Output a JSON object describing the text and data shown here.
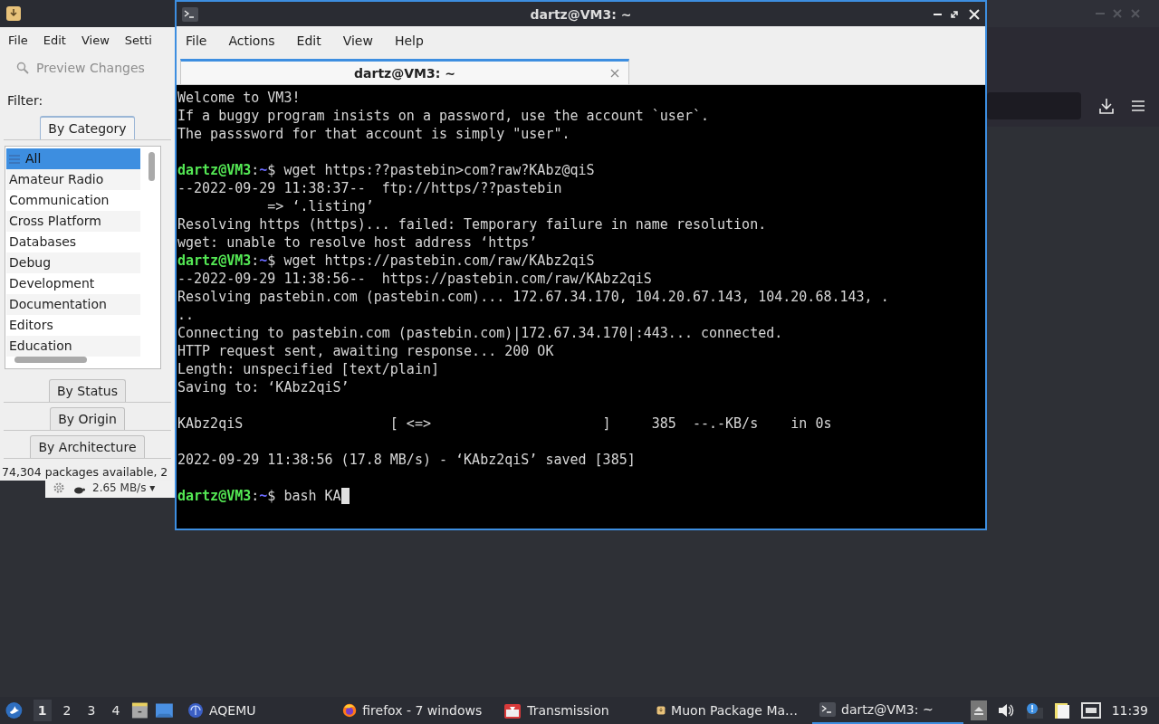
{
  "muon": {
    "menu": [
      "File",
      "Edit",
      "View",
      "Setti"
    ],
    "toolbar_action": {
      "label": "Preview Changes",
      "disabled": true
    },
    "filter_label": "Filter:",
    "filter_tabs": [
      {
        "label": "By Category",
        "selected": true
      },
      {
        "label": "By Status",
        "selected": false
      },
      {
        "label": "By Origin",
        "selected": false
      },
      {
        "label": "By Architecture",
        "selected": false
      }
    ],
    "categories": [
      {
        "label": "All",
        "selected": true
      },
      {
        "label": "Amateur Radio",
        "selected": false
      },
      {
        "label": "Communication",
        "selected": false
      },
      {
        "label": "Cross Platform",
        "selected": false
      },
      {
        "label": "Databases",
        "selected": false
      },
      {
        "label": "Debug",
        "selected": false
      },
      {
        "label": "Development",
        "selected": false
      },
      {
        "label": "Documentation",
        "selected": false
      },
      {
        "label": "Editors",
        "selected": false
      },
      {
        "label": "Education",
        "selected": false
      }
    ],
    "status_bar": "74,304 packages available, 2"
  },
  "transmission_bar": {
    "speed": "2.65 MB/s ▾"
  },
  "terminal": {
    "title": "dartz@VM3: ~",
    "menu": [
      "File",
      "Actions",
      "Edit",
      "View",
      "Help"
    ],
    "tab": {
      "label": "dartz@VM3: ~",
      "selected": true
    },
    "lines": [
      {
        "kind": "output",
        "text": "Welcome to VM3!"
      },
      {
        "kind": "output",
        "text": "If a buggy program insists on a password, use the account `user`."
      },
      {
        "kind": "output",
        "text": "The passsword for that account is simply \"user\"."
      },
      {
        "kind": "blank"
      },
      {
        "kind": "prompt",
        "user": "dartz@VM3",
        "colon": ":",
        "path": "~",
        "sign": "$",
        "command": "wget https:??pastebin>com?raw?KAbz@qiS"
      },
      {
        "kind": "output",
        "text": "--2022-09-29 11:38:37--  ftp://https/??pastebin"
      },
      {
        "kind": "output",
        "text": "           => ‘.listing’"
      },
      {
        "kind": "output",
        "text": "Resolving https (https)... failed: Temporary failure in name resolution."
      },
      {
        "kind": "output",
        "text": "wget: unable to resolve host address ‘https’"
      },
      {
        "kind": "prompt",
        "user": "dartz@VM3",
        "colon": ":",
        "path": "~",
        "sign": "$",
        "command": "wget https://pastebin.com/raw/KAbz2qiS"
      },
      {
        "kind": "output",
        "text": "--2022-09-29 11:38:56--  https://pastebin.com/raw/KAbz2qiS"
      },
      {
        "kind": "output",
        "text": "Resolving pastebin.com (pastebin.com)... 172.67.34.170, 104.20.67.143, 104.20.68.143, ."
      },
      {
        "kind": "output",
        "text": ".."
      },
      {
        "kind": "output",
        "text": "Connecting to pastebin.com (pastebin.com)|172.67.34.170|:443... connected."
      },
      {
        "kind": "output",
        "text": "HTTP request sent, awaiting response... 200 OK"
      },
      {
        "kind": "output",
        "text": "Length: unspecified [text/plain]"
      },
      {
        "kind": "output",
        "text": "Saving to: ‘KAbz2qiS’"
      },
      {
        "kind": "blank"
      },
      {
        "kind": "output",
        "text": "KAbz2qiS                  [ <=>                     ]     385  --.-KB/s    in 0s"
      },
      {
        "kind": "blank"
      },
      {
        "kind": "output",
        "text": "2022-09-29 11:38:56 (17.8 MB/s) - ‘KAbz2qiS’ saved [385]"
      },
      {
        "kind": "blank"
      },
      {
        "kind": "prompt",
        "user": "dartz@VM3",
        "colon": ":",
        "path": "~",
        "sign": "$",
        "command": "bash KA",
        "cursor": true
      }
    ]
  },
  "taskbar": {
    "workspaces": [
      {
        "label": "1",
        "selected": true
      },
      {
        "label": "2",
        "selected": false
      },
      {
        "label": "3",
        "selected": false
      },
      {
        "label": "4",
        "selected": false
      }
    ],
    "tasks": [
      {
        "kind": "emulator",
        "label": "AQEMU",
        "selected": false
      },
      {
        "kind": "firefox",
        "label": "firefox - 7 windows",
        "selected": false
      },
      {
        "kind": "transmission",
        "label": "Transmission",
        "selected": false
      },
      {
        "kind": "muon",
        "label": "Muon Package Ma…",
        "selected": false
      },
      {
        "kind": "terminal",
        "label": "dartz@VM3: ~",
        "selected": true
      }
    ],
    "clock": "11:39"
  }
}
